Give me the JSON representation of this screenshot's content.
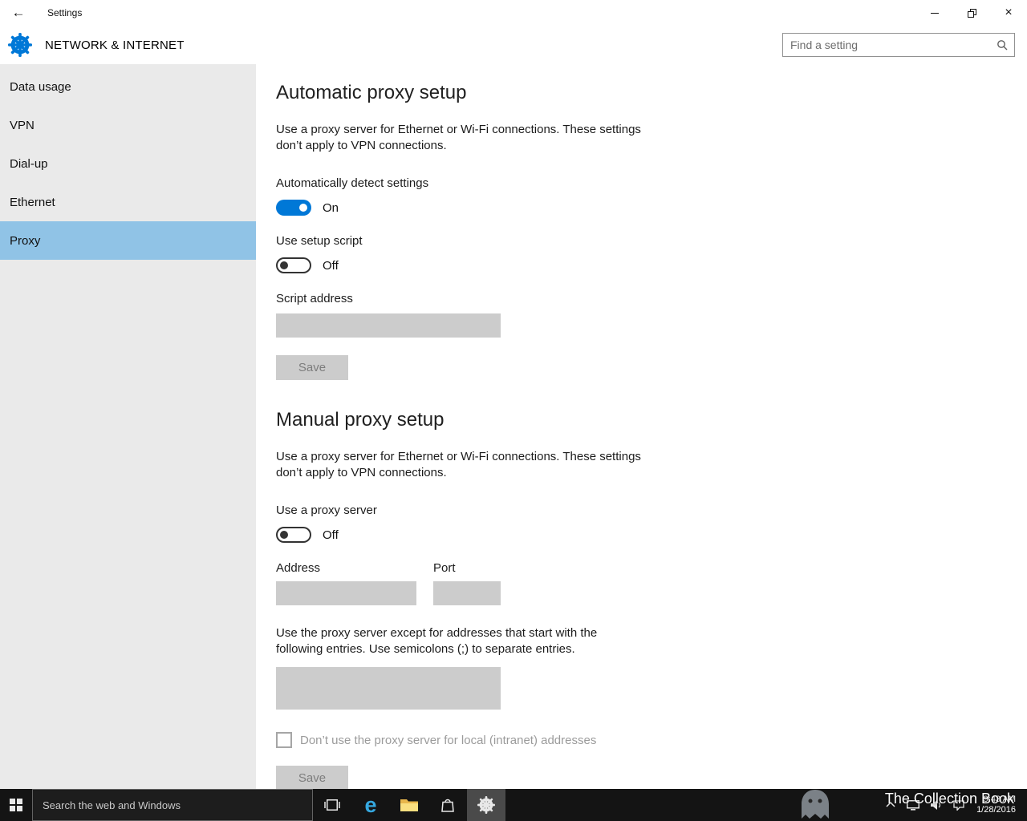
{
  "colors": {
    "accent": "#0078d7",
    "sidebar_selected": "#90c3e6",
    "taskbar": "#141414",
    "field_gray": "#cccccc"
  },
  "titlebar": {
    "title": "Settings",
    "back_icon": "←",
    "close_icon": "×"
  },
  "header": {
    "page_title": "NETWORK & INTERNET",
    "search_placeholder": "Find a setting"
  },
  "sidebar": {
    "items": [
      {
        "label": "Data usage",
        "selected": false
      },
      {
        "label": "VPN",
        "selected": false
      },
      {
        "label": "Dial-up",
        "selected": false
      },
      {
        "label": "Ethernet",
        "selected": false
      },
      {
        "label": "Proxy",
        "selected": true
      }
    ]
  },
  "automatic_proxy": {
    "heading": "Automatic proxy setup",
    "description": "Use a proxy server for Ethernet or Wi-Fi connections. These settings don’t apply to VPN connections.",
    "detect_label": "Automatically detect settings",
    "detect_state": "On",
    "script_label": "Use setup script",
    "script_state": "Off",
    "script_address_label": "Script address",
    "script_address_value": "",
    "save_label": "Save"
  },
  "manual_proxy": {
    "heading": "Manual proxy setup",
    "description": "Use a proxy server for Ethernet or Wi-Fi connections. These settings don’t apply to VPN connections.",
    "use_proxy_label": "Use a proxy server",
    "use_proxy_state": "Off",
    "address_label": "Address",
    "address_value": "",
    "port_label": "Port",
    "port_value": "",
    "exceptions_text": "Use the proxy server except for addresses that start with the following entries. Use semicolons (;) to separate entries.",
    "exceptions_value": "",
    "local_checkbox_label": "Don’t use the proxy server for local (intranet) addresses",
    "local_checkbox_checked": false,
    "save_label": "Save"
  },
  "taskbar": {
    "search_placeholder": "Search the web and Windows",
    "edge_glyph": "e",
    "time": "9:43 AM",
    "date": "1/28/2016"
  },
  "watermark": {
    "text": "The Collection Book"
  }
}
